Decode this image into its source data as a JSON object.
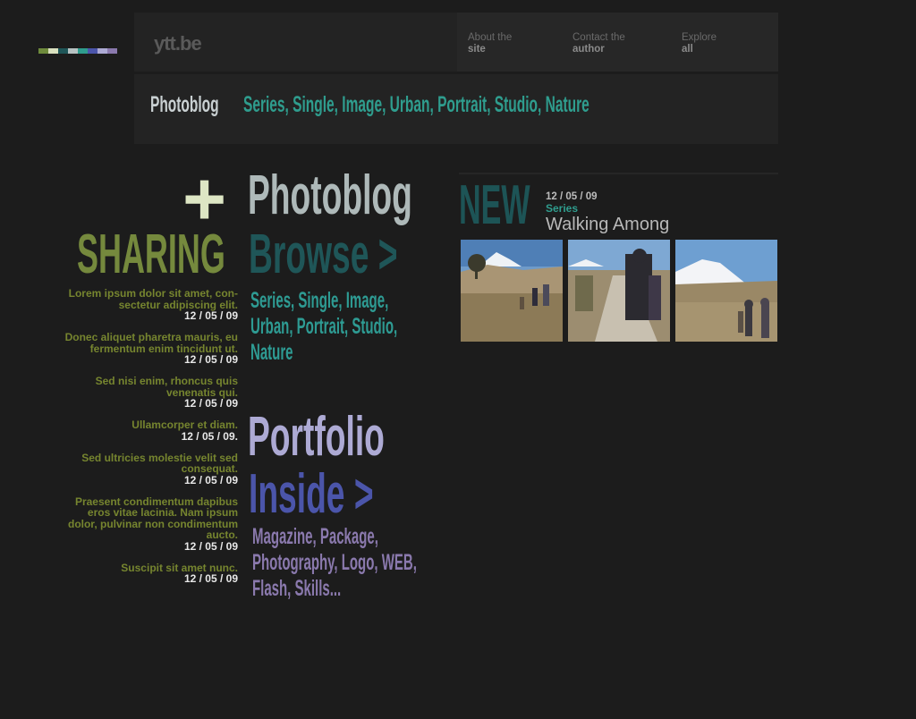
{
  "site": {
    "logo": "ytt.be",
    "nav": [
      {
        "line1": "About the",
        "line2": "site"
      },
      {
        "line1": "Contact the",
        "line2": "author"
      },
      {
        "line1": "Explore",
        "line2": "all"
      }
    ]
  },
  "palette": [
    "#6e8a3c",
    "#d9e0be",
    "#1f5658",
    "#b7c2c2",
    "#2f9d8e",
    "#4b55aa",
    "#adaad4",
    "#8a79ad"
  ],
  "subbar": {
    "title": "Photoblog",
    "categories": "Series, Single, Image, Urban, Portrait, Studio, Nature"
  },
  "headings": {
    "plus": "+",
    "photoblog": "Photoblog",
    "sharing": "SHARING",
    "browse": "Browse >",
    "portfolio": "Portfolio",
    "inside": "Inside >"
  },
  "browse_links": [
    "Series, Single, Image,",
    "Urban, Portrait, Studio,",
    "Nature"
  ],
  "inside_links": [
    "Magazine, Package,",
    "Photography, Logo, WEB,",
    "Flash, Skills..."
  ],
  "news": [
    {
      "text": [
        "Lorem ipsum dolor sit amet, con-",
        "sectetur adipiscing elit."
      ],
      "date": "12 / 05 / 09"
    },
    {
      "text": [
        "Donec aliquet pharetra mauris, eu",
        "fermentum enim tincidunt ut."
      ],
      "date": "12 / 05 / 09"
    },
    {
      "text": [
        "Sed nisi enim, rhoncus quis",
        "venenatis qui."
      ],
      "date": "12 / 05 / 09"
    },
    {
      "text": [
        "Ullamcorper et diam."
      ],
      "date": "12 / 05 / 09."
    },
    {
      "text": [
        "Sed ultricies molestie velit sed",
        "consequat."
      ],
      "date": "12 / 05 / 09"
    },
    {
      "text": [
        "Praesent condimentum dapibus",
        "eros vitae lacinia. Nam ipsum",
        "dolor, pulvinar non condimentum",
        "aucto."
      ],
      "date": "12 / 05 / 09"
    },
    {
      "text": [
        "Suscipit sit amet nunc."
      ],
      "date": "12 / 05 / 09"
    }
  ],
  "new_block": {
    "label": "NEW",
    "date": "12 / 05 / 09",
    "category": "Series",
    "title": "Walking Among"
  }
}
